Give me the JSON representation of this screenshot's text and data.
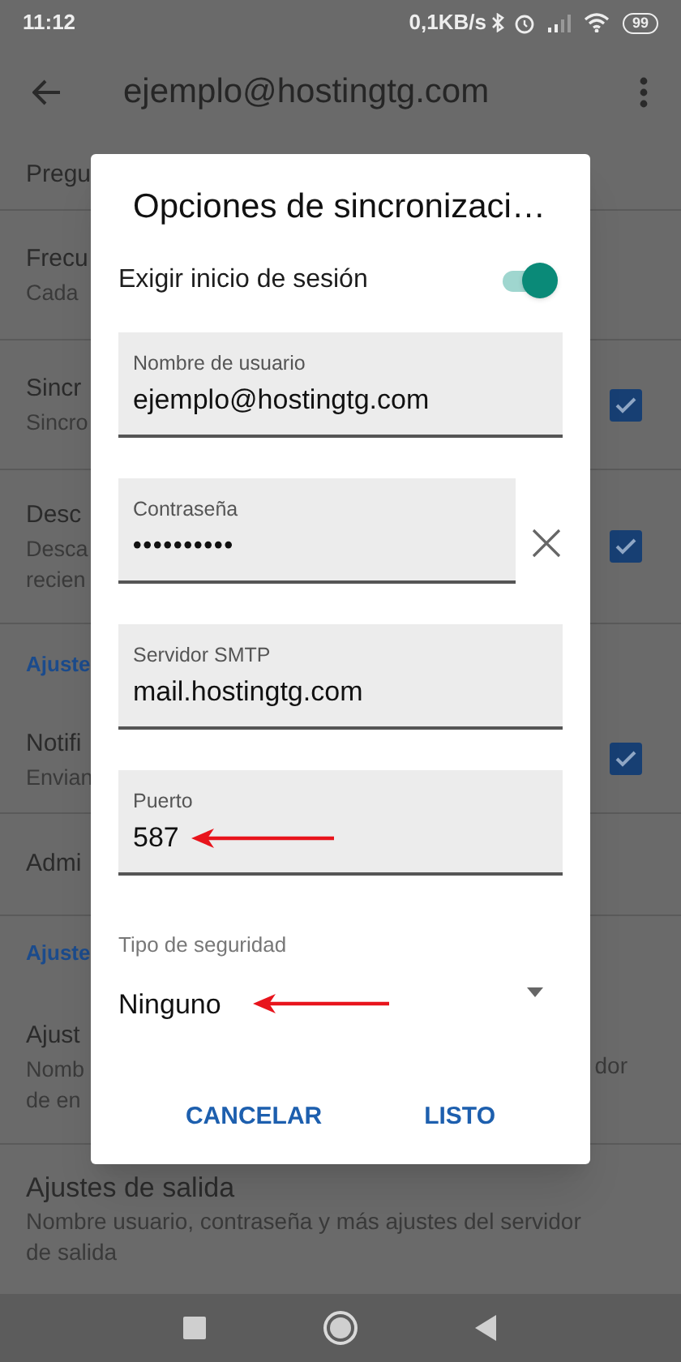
{
  "status_bar": {
    "time": "11:12",
    "net_speed": "0,1KB/s",
    "battery": "99"
  },
  "app_bar": {
    "title": "ejemplo@hostingtg.com"
  },
  "settings": [
    {
      "kind": "item",
      "lines": [
        "Pregu"
      ]
    },
    {
      "kind": "item",
      "lines": [
        "Frecu",
        "Cada"
      ]
    },
    {
      "kind": "item",
      "lines": [
        "Sincr",
        "Sincro"
      ],
      "checked": true
    },
    {
      "kind": "item",
      "lines": [
        "Desc",
        "Desca",
        "recien"
      ],
      "checked": true
    },
    {
      "kind": "header",
      "lines": [
        "Ajuste"
      ]
    },
    {
      "kind": "item",
      "lines": [
        "Notifi",
        "Envian"
      ],
      "checked": true
    },
    {
      "kind": "item",
      "lines": [
        "Admi"
      ]
    },
    {
      "kind": "header",
      "lines": [
        "Ajuste"
      ]
    },
    {
      "kind": "item",
      "lines": [
        "Ajust",
        "Nomb",
        "de en"
      ],
      "right_text": "dor"
    },
    {
      "kind": "item",
      "lines": [
        "Ajustes de salida",
        "Nombre usuario, contraseña y más ajustes del servidor",
        "de salida"
      ]
    }
  ],
  "dialog": {
    "title": "Opciones de sincronizaci…",
    "toggle": {
      "label": "Exigir inicio de sesión",
      "on": true
    },
    "fields": [
      {
        "kind": "text",
        "label": "Nombre de usuario",
        "value": "ejemplo@hostingtg.com",
        "annotated": false
      },
      {
        "kind": "password",
        "label": "Contraseña",
        "value": "••••••••••",
        "annotated": false
      },
      {
        "kind": "text",
        "label": "Servidor SMTP",
        "value": "mail.hostingtg.com",
        "annotated": false
      },
      {
        "kind": "text",
        "label": "Puerto",
        "value": "587",
        "annotated": true
      },
      {
        "kind": "select",
        "label": "Tipo de seguridad",
        "value": "Ninguno",
        "annotated": true
      }
    ],
    "buttons": [
      "CANCELAR",
      "LISTO"
    ]
  }
}
